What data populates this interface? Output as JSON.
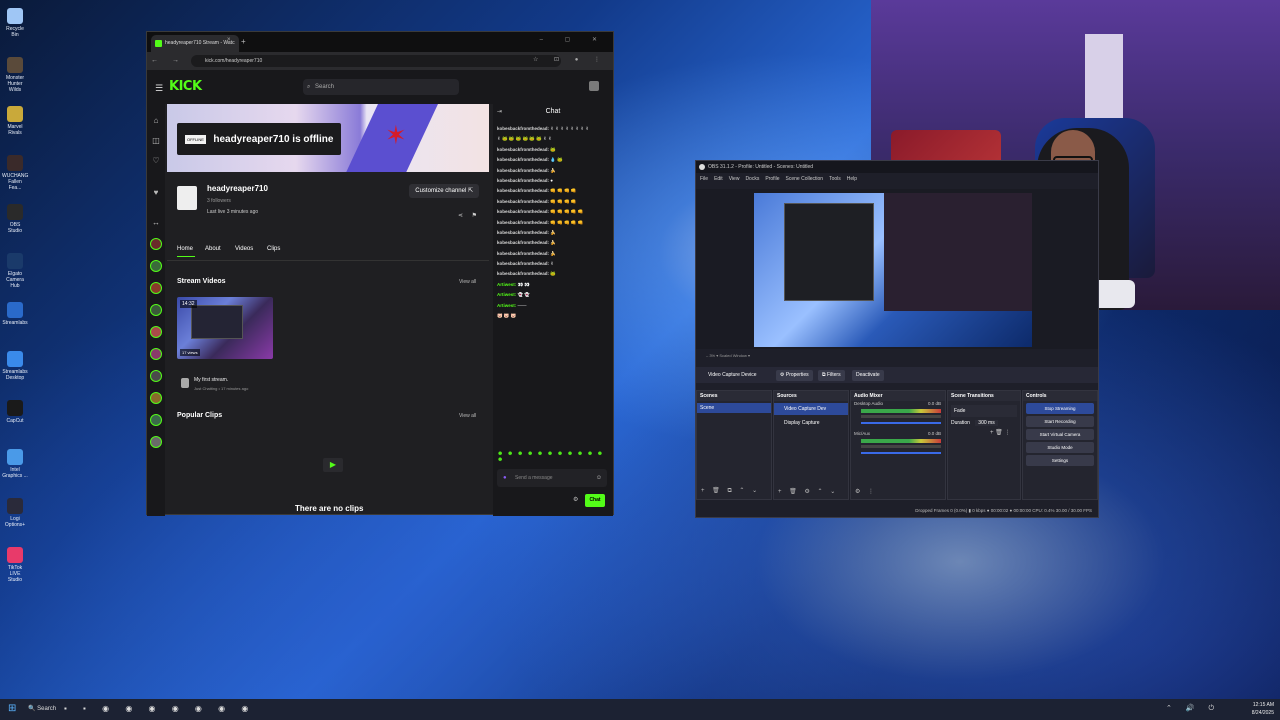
{
  "desktop": {
    "icons": [
      {
        "label": "Recycle Bin",
        "color": "#9fc6f5"
      },
      {
        "label": "Monster Hunter Wilds",
        "color": "#5a4a3a"
      },
      {
        "label": "Marvel Rivals",
        "color": "#c9a93a"
      },
      {
        "label": "WUCHANG Fallen Fea...",
        "color": "#3a2a2a"
      },
      {
        "label": "OBS Studio",
        "color": "#2a2a2a"
      },
      {
        "label": "Elgato Camera Hub",
        "color": "#1a3a6a"
      },
      {
        "label": "Streamlabs",
        "color": "#2a6aca"
      },
      {
        "label": "Streamlabs Desktop",
        "color": "#3a8aea"
      },
      {
        "label": "CapCut",
        "color": "#1a1a1a"
      },
      {
        "label": "Intel Graphics ...",
        "color": "#4a9ae8"
      },
      {
        "label": "Logi Options+",
        "color": "#2a2a3a"
      },
      {
        "label": "TikTok LIVE Studio",
        "color": "#e83a6a"
      }
    ]
  },
  "browser": {
    "tab_title": "headyreaper710 Stream - Watc",
    "tab_close": "×",
    "new_tab": "+",
    "window_controls": "– ▢ ✕",
    "nav_icons": "← → ⟳",
    "url": "kick.com/headyreaper710",
    "addr_icons": "☆ ⊡ ● ⋮"
  },
  "kick": {
    "logo": "KICK",
    "search_placeholder": "Search",
    "offline_badge": "OFFLINE",
    "offline_text": "headyreaper710 is offline",
    "channel": {
      "name": "headyreaper710",
      "followers": "3 followers",
      "last_live": "Last live 3 minutes ago",
      "customize_label": "Customize channel"
    },
    "tabs": [
      "Home",
      "About",
      "Videos",
      "Clips"
    ],
    "stream_videos_title": "Stream Videos",
    "view_all": "View all",
    "video": {
      "duration": "14:32",
      "views": "17 views",
      "title": "My first stream.",
      "meta": "Just Chatting • 17 minutes ago"
    },
    "popular_clips_title": "Popular Clips",
    "no_clips": "There are no clips",
    "chat": {
      "header": "Chat",
      "lines": [
        {
          "user": "kobesbackfromthedead:",
          "msg": "✌ ✌ ✌ ✌ ✌ ✌ ✌ ✌",
          "color": "#d9d9d9"
        },
        {
          "user": "",
          "msg": "✌ 🐸 🐸 🐸 🐸 🐸 🐸 ✌ ✌",
          "color": "#d9d9d9"
        },
        {
          "user": "kobesbackfromthedead:",
          "msg": "🐸",
          "color": "#d9d9d9"
        },
        {
          "user": "kobesbackfromthedead:",
          "msg": "💧 🐸",
          "color": "#d9d9d9"
        },
        {
          "user": "kobesbackfromthedead:",
          "msg": "🍌",
          "color": "#d9d9d9"
        },
        {
          "user": "kobesbackfromthedead:",
          "msg": "●",
          "color": "#d9d9d9"
        },
        {
          "user": "kobesbackfromthedead:",
          "msg": "👊 👊 👊 👊",
          "color": "#d9d9d9"
        },
        {
          "user": "kobesbackfromthedead:",
          "msg": "👊 👊 👊 👊",
          "color": "#d9d9d9"
        },
        {
          "user": "kobesbackfromthedead:",
          "msg": "👊 👊 👊 👊 👊",
          "color": "#d9d9d9"
        },
        {
          "user": "kobesbackfromthedead:",
          "msg": "👊 👊 👊 👊 👊",
          "color": "#d9d9d9"
        },
        {
          "user": "kobesbackfromthedead:",
          "msg": "🍌",
          "color": "#d9d9d9"
        },
        {
          "user": "kobesbackfromthedead:",
          "msg": "🍌",
          "color": "#d9d9d9"
        },
        {
          "user": "kobesbackfromthedead:",
          "msg": "🍌",
          "color": "#d9d9d9"
        },
        {
          "user": "kobesbackfromthedead:",
          "msg": "✌",
          "color": "#d9d9d9"
        },
        {
          "user": "kobesbackfromthedead:",
          "msg": "🐸",
          "color": "#d9d9d9"
        },
        {
          "user": "Artiwest:",
          "msg": "👀 👀",
          "color": "#53fc18"
        },
        {
          "user": "Artiwest:",
          "msg": "👻 👻",
          "color": "#53fc18"
        },
        {
          "user": "Artiwest:",
          "msg": "——",
          "color": "#53fc18"
        },
        {
          "user": "",
          "msg": "🐷 🐷 🐷",
          "color": "#e8384a"
        }
      ],
      "emote_bar": "☻ ☻ ☻ ☻ ☻ ☻ ☻ ☻ ☻ ☻ ☻ ☻",
      "input_placeholder": "Send a message",
      "send_label": "Chat"
    }
  },
  "obs": {
    "title": "OBS 31.1.2 - Profile: Untitled - Scenes: Untitled",
    "menu": [
      "File",
      "Edit",
      "View",
      "Docks",
      "Profile",
      "Scene Collection",
      "Tools",
      "Help"
    ],
    "preview_bar": "– 3% ▾   Scaled Window ▾",
    "source_name": "Video Capture Device",
    "properties": "⚙ Properties",
    "filters": "⧉ Filters",
    "deactivate": "Deactivate",
    "scenes_header": "Scenes",
    "scene_item": "Scene",
    "sources_header": "Sources",
    "sources": [
      "Video Capture Dev",
      "Display Capture"
    ],
    "mixer_header": "Audio Mixer",
    "mixer": [
      {
        "name": "Desktop Audio",
        "level": "0.0 dB"
      },
      {
        "name": "Mic/Aux",
        "level": "0.0 dB"
      }
    ],
    "transitions_header": "Scene Transitions",
    "transition": "Fade",
    "duration_label": "Duration",
    "duration_value": "300 ms",
    "controls_header": "Controls",
    "controls": [
      "Stop Streaming",
      "Start Recording",
      "Start Virtual Camera",
      "Studio Mode",
      "Settings"
    ],
    "status": "Dropped Frames 0 (0.0%)   ▮ 0 kbps   ● 00:00:02   ● 00:00:00   CPU: 0.4%   30.00 / 30.00 FPS"
  },
  "taskbar": {
    "start": "⊞",
    "search": "🔍 Search",
    "apps": "▪ ▪ ◉ ◉ ◉ ◉ ◉ ◉ ◉",
    "tray": "⌃ 🔊 ⏻",
    "time": "12:15 AM",
    "date": "8/24/2025"
  }
}
